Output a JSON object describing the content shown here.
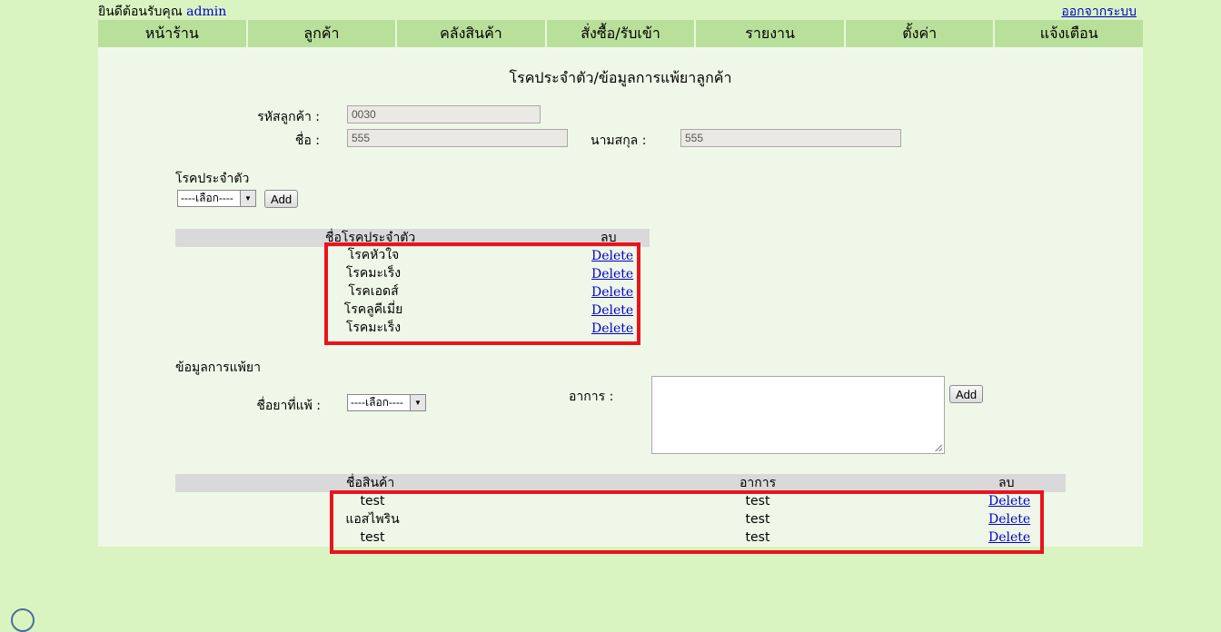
{
  "header": {
    "welcome_text": "ยินดีต้อนรับคุณ",
    "username": "admin",
    "logout_label": "ออกจากระบบ"
  },
  "nav": {
    "items": [
      {
        "label": "หน้าร้าน"
      },
      {
        "label": "ลูกค้า"
      },
      {
        "label": "คลังสินค้า"
      },
      {
        "label": "สั่งซื้อ/รับเข้า"
      },
      {
        "label": "รายงาน"
      },
      {
        "label": "ตั้งค่า"
      },
      {
        "label": "แจ้งเตือน"
      }
    ]
  },
  "page": {
    "title": "โรคประจำตัว/ข้อมูลการแพ้ยาลูกค้า"
  },
  "customer": {
    "id_label": "รหัสลูกค้า :",
    "id_value": "0030",
    "name_label": "ชื่อ :",
    "name_value": "555",
    "surname_label": "นามสกุล :",
    "surname_value": "555"
  },
  "disease_section": {
    "heading": "โรคประจำตัว",
    "select_value": "----เลือก----",
    "add_label": "Add",
    "col_name": "ชื่อโรคประจำตัว",
    "col_delete": "ลบ",
    "rows": [
      {
        "name": "โรคหัวใจ",
        "action": "Delete"
      },
      {
        "name": "โรคมะเร็ง",
        "action": "Delete"
      },
      {
        "name": "โรคเอดส์",
        "action": "Delete"
      },
      {
        "name": "โรคลูคีเมี่ย",
        "action": "Delete"
      },
      {
        "name": "โรคมะเร็ง",
        "action": "Delete"
      }
    ]
  },
  "allergy_section": {
    "heading": "ข้อมูลการแพ้ยา",
    "drug_label": "ชื่อยาที่แพ้ :",
    "select_value": "----เลือก----",
    "symptom_label": "อาการ :",
    "symptom_value": "",
    "add_label": "Add",
    "col_product": "ชื่อสินค้า",
    "col_symptom": "อาการ",
    "col_delete": "ลบ",
    "rows": [
      {
        "product": "test",
        "symptom": "test",
        "action": "Delete"
      },
      {
        "product": "แอสไพริน",
        "symptom": "test",
        "action": "Delete"
      },
      {
        "product": "test",
        "symptom": "test",
        "action": "Delete"
      }
    ]
  },
  "colors": {
    "background": "#d9f4c0",
    "nav": "#b9e09a",
    "panel": "#eff8e8",
    "highlight": "#e8141c",
    "link": "#0000cc"
  }
}
